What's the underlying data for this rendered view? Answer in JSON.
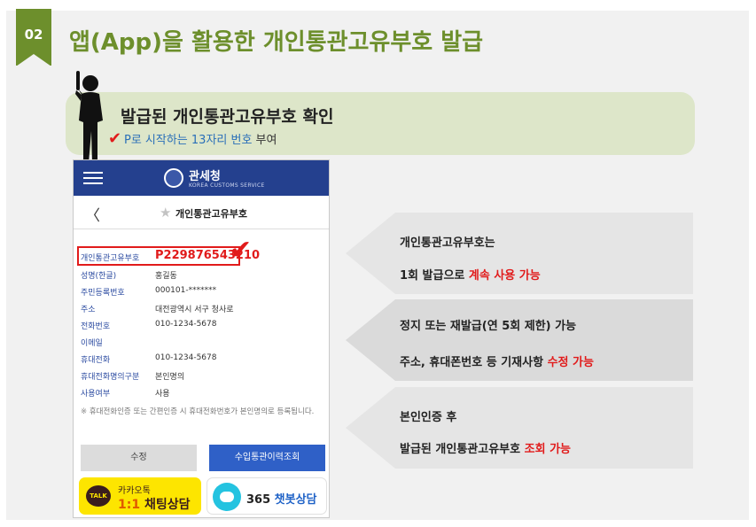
{
  "header": {
    "section_number": "02",
    "title": "앱(App)을 활용한 개인통관고유부호 발급"
  },
  "banner": {
    "title": "발급된 개인통관고유부호 확인",
    "subtitle_highlight": "P로 시작하는 13자리 번호",
    "subtitle_tail": " 부여"
  },
  "phone": {
    "app_title": "관세청",
    "app_subtitle": "KOREA CUSTOMS SERVICE",
    "page_title": "개인통관고유부호",
    "rows": [
      {
        "label": "개인통관고유부호",
        "value": "P229876543210"
      },
      {
        "label": "성명(한글)",
        "value": "홍길동"
      },
      {
        "label": "주민등록번호",
        "value": "000101-*******"
      },
      {
        "label": "주소",
        "value": "대전광역시 서구 청사로"
      },
      {
        "label": "전화번호",
        "value": "010-1234-5678"
      },
      {
        "label": "이메일",
        "value": ""
      },
      {
        "label": "휴대전화",
        "value": "010-1234-5678"
      },
      {
        "label": "휴대전화명의구분",
        "value": "본인명의"
      },
      {
        "label": "사용여부",
        "value": "사용"
      }
    ],
    "note": "휴대전화인증 또는 간편인증 시 휴대전화번호가 본인명의로 등록됩니다.",
    "edit_button": "수정",
    "history_button": "수입통관이력조회",
    "kakao_top": "카카오톡",
    "kakao_num": "1:1",
    "kakao_label": " 채팅상담",
    "kakao_badge": "TALK",
    "chatbot_num": "365",
    "chatbot_label": " 챗봇상담"
  },
  "panels": [
    {
      "line1": "개인통관고유부호는",
      "line2_plain": "1회 발급으로 ",
      "line2_red": "계속 사용 가능"
    },
    {
      "line1": "정지 또는 재발급(연 5회 제한) 가능",
      "line2_plain": "주소, 휴대폰번호 등 기재사항 ",
      "line2_red": "수정 가능"
    },
    {
      "line1": "본인인증 후",
      "line2_plain": "발급된 개인통관고유부호 ",
      "line2_red": "조회 가능"
    }
  ],
  "colors": {
    "accent_green": "#6d8f2c",
    "highlight_red": "#e11b1b",
    "brand_blue": "#24408e"
  }
}
